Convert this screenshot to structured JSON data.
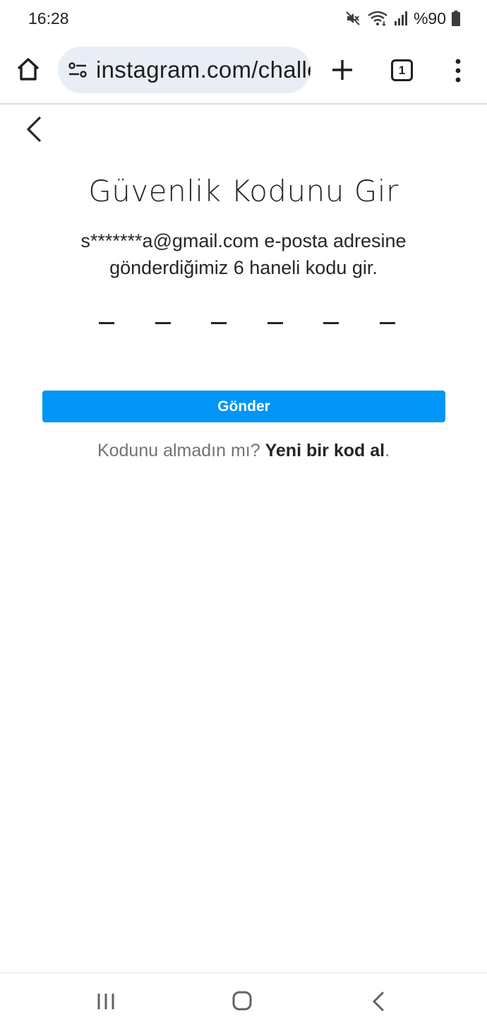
{
  "status_bar": {
    "time": "16:28",
    "battery": "%90",
    "icons": [
      "mute-icon",
      "wifi-icon",
      "signal-icon",
      "battery-icon"
    ]
  },
  "browser": {
    "url": "instagram.com/challenge",
    "tab_count": "1",
    "icons": [
      "home-icon",
      "site-settings-icon",
      "new-tab-icon",
      "tabs-icon",
      "menu-icon"
    ]
  },
  "page": {
    "title": "Güvenlik Kodunu Gir",
    "subtitle": "s*******a@gmail.com e-posta adresine gönderdiğimiz 6 haneli kodu gir.",
    "code_slots": [
      "",
      "",
      "",
      "",
      "",
      ""
    ],
    "submit_label": "Gönder",
    "resend_prompt": "Kodunu almadın mı? ",
    "resend_link": "Yeni bir kod al",
    "resend_suffix": "."
  },
  "colors": {
    "primary_button": "#0095f6",
    "text": "#262626",
    "secondary_text": "#737373",
    "url_bar": "#e9eef6"
  }
}
